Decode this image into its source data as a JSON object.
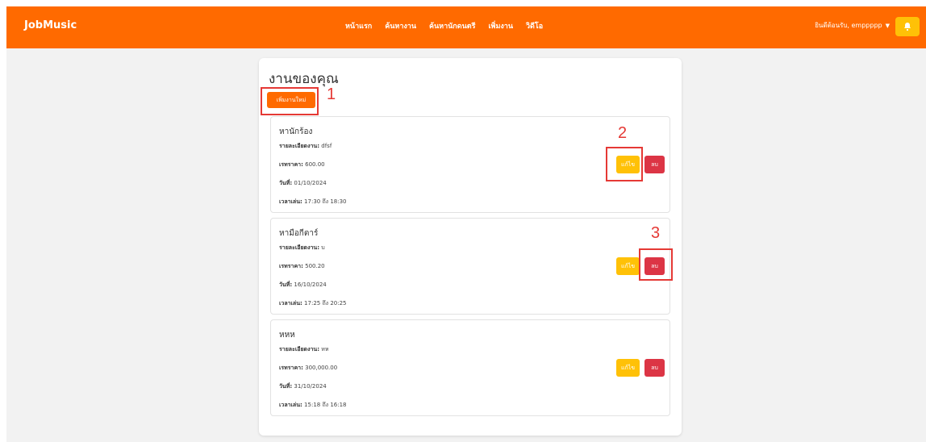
{
  "navbar": {
    "brand": "JobMusic",
    "links": [
      "หน้าแรก",
      "ค้นหางาน",
      "ค้นหานักดนตรี",
      "เพิ่มงาน",
      "วิดีโอ"
    ],
    "user_label": "ยินดีต้อนรับ, emppppp",
    "bell_icon": "bell-icon",
    "color": "#ff6a00"
  },
  "page": {
    "title": "งานของคุณ",
    "new_job_label": "เพิ่มงานใหม่"
  },
  "annotations": [
    "1",
    "2",
    "3"
  ],
  "labels": {
    "desc": "รายละเอียดงาน:",
    "price": "เรทราคา:",
    "date": "วันที่:",
    "time": "เวลาเล่น:",
    "edit": "แก้ไข",
    "delete": "ลบ"
  },
  "jobs": [
    {
      "name": "หานักร้อง",
      "desc": "dfsf",
      "price": "600.00",
      "date": "01/10/2024",
      "time": "17:30 ถึง 18:30"
    },
    {
      "name": "หามือกีตาร์",
      "desc": "บ",
      "price": "500.20",
      "date": "16/10/2024",
      "time": "17:25 ถึง 20:25"
    },
    {
      "name": "หหห",
      "desc": "หห",
      "price": "300,000.00",
      "date": "31/10/2024",
      "time": "15:18 ถึง 16:18"
    }
  ],
  "colors": {
    "accent": "#ff6a00",
    "edit": "#ffc107",
    "delete": "#dc3545",
    "highlight": "#e53935"
  }
}
